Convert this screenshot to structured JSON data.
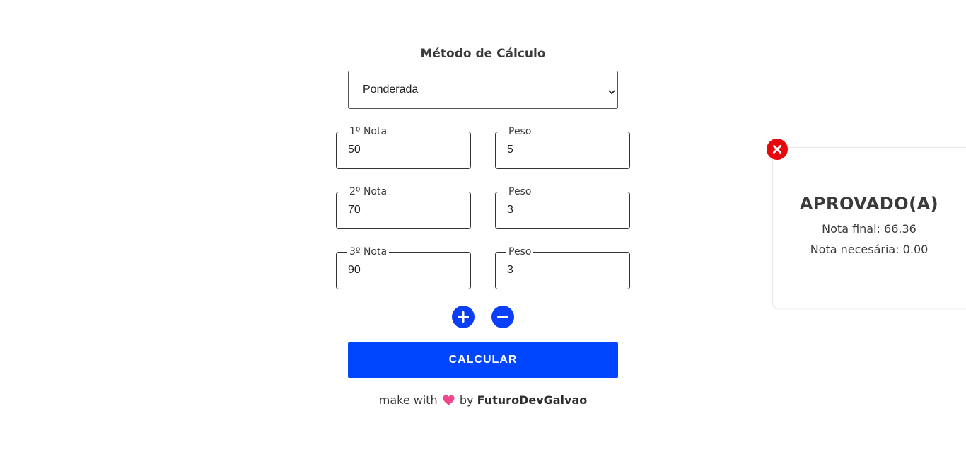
{
  "calculator": {
    "method_title": "Método de Cálculo",
    "method_select": {
      "value": "Ponderada"
    },
    "grades": [
      {
        "label": "1º Nota",
        "value": "50",
        "weight_label": "Peso",
        "weight": "5"
      },
      {
        "label": "2º Nota",
        "value": "70",
        "weight_label": "Peso",
        "weight": "3"
      },
      {
        "label": "3º Nota",
        "value": "90",
        "weight_label": "Peso",
        "weight": "3"
      }
    ],
    "add_icon": "plus-circle-icon",
    "remove_icon": "minus-circle-icon",
    "calculate_label": "CALCULAR"
  },
  "footer": {
    "prefix": "make with",
    "heart_icon": "heart-icon",
    "by": "by",
    "author": "FuturoDevGalvao"
  },
  "result": {
    "close_icon": "close-icon",
    "status": "APROVADO(A)",
    "final_label": "Nota final: 66.36",
    "needed_label": "Nota necesária: 0.00"
  },
  "colors": {
    "primary": "#0046ff",
    "close": "#e8070b",
    "heart": "#f0468c"
  }
}
